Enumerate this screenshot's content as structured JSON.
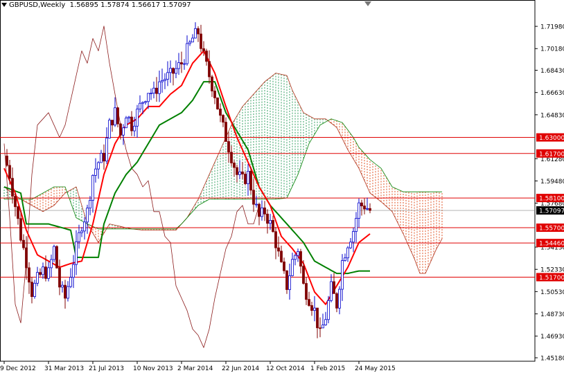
{
  "header": {
    "symbol": "GBPUSD,Weekly",
    "ohlc": "1.56895 1.57874 1.56617 1.57097"
  },
  "colors": {
    "bull_candle": "#0000cc",
    "bear_candle": "#800000",
    "tenkan": "#ff0000",
    "kijun": "#008000",
    "chikou": "#8b1a1a",
    "cloud_up": "#2e9e5e",
    "cloud_down": "#e05020",
    "level_line": "#e00000",
    "level_label_bg": "#e00000",
    "current_label_bg": "#000000",
    "grid": "#c8c8c8"
  },
  "chart_data": {
    "type": "candlestick",
    "title": "GBPUSD,Weekly",
    "ylim": [
      1.4518,
      1.7288
    ],
    "y_ticks": [
      "1.71980",
      "1.70180",
      "1.68430",
      "1.66630",
      "1.64830",
      "1.61280",
      "1.59480",
      "1.57680",
      "1.54130",
      "1.52330",
      "1.50530",
      "1.48730",
      "1.46930",
      "1.45180"
    ],
    "x_ticks": [
      "9 Dec 2012",
      "31 Mar 2013",
      "21 Jul 2013",
      "10 Nov 2013",
      "2 Mar 2014",
      "22 Jun 2014",
      "12 Oct 2014",
      "1 Feb 2015",
      "24 May 2015"
    ],
    "x_tick_index": [
      0,
      16,
      32,
      48,
      64,
      80,
      96,
      112,
      128
    ],
    "levels": [
      {
        "label": "1.63000",
        "value": 1.63
      },
      {
        "label": "1.61700",
        "value": 1.617
      },
      {
        "label": "1.58100",
        "value": 1.581
      },
      {
        "label": "1.55700",
        "value": 1.557
      },
      {
        "label": "1.54460",
        "value": 1.5446
      },
      {
        "label": "1.51700",
        "value": 1.517
      }
    ],
    "current_price": {
      "label": "1.57097",
      "value": 1.57097
    },
    "close_anchors": [
      [
        0,
        1.615
      ],
      [
        2,
        1.6
      ],
      [
        4,
        1.575
      ],
      [
        6,
        1.55
      ],
      [
        8,
        1.53
      ],
      [
        10,
        1.505
      ],
      [
        12,
        1.515
      ],
      [
        14,
        1.522
      ],
      [
        16,
        1.52
      ],
      [
        18,
        1.54
      ],
      [
        20,
        1.51
      ],
      [
        22,
        1.5
      ],
      [
        24,
        1.52
      ],
      [
        26,
        1.54
      ],
      [
        28,
        1.56
      ],
      [
        30,
        1.57
      ],
      [
        32,
        1.6
      ],
      [
        34,
        1.61
      ],
      [
        36,
        1.615
      ],
      [
        38,
        1.64
      ],
      [
        40,
        1.65
      ],
      [
        42,
        1.632
      ],
      [
        44,
        1.65
      ],
      [
        46,
        1.64
      ],
      [
        48,
        1.65
      ],
      [
        50,
        1.66
      ],
      [
        52,
        1.668
      ],
      [
        54,
        1.665
      ],
      [
        56,
        1.675
      ],
      [
        58,
        1.678
      ],
      [
        60,
        1.68
      ],
      [
        62,
        1.685
      ],
      [
        64,
        1.69
      ],
      [
        66,
        1.7
      ],
      [
        68,
        1.71
      ],
      [
        70,
        1.715
      ],
      [
        72,
        1.695
      ],
      [
        74,
        1.68
      ],
      [
        76,
        1.665
      ],
      [
        78,
        1.645
      ],
      [
        80,
        1.63
      ],
      [
        82,
        1.615
      ],
      [
        84,
        1.6
      ],
      [
        86,
        1.595
      ],
      [
        88,
        1.6
      ],
      [
        90,
        1.58
      ],
      [
        92,
        1.565
      ],
      [
        94,
        1.57
      ],
      [
        96,
        1.56
      ],
      [
        98,
        1.545
      ],
      [
        100,
        1.525
      ],
      [
        102,
        1.51
      ],
      [
        104,
        1.53
      ],
      [
        106,
        1.54
      ],
      [
        108,
        1.51
      ],
      [
        110,
        1.5
      ],
      [
        112,
        1.49
      ],
      [
        114,
        1.47
      ],
      [
        116,
        1.485
      ],
      [
        118,
        1.508
      ],
      [
        120,
        1.495
      ],
      [
        122,
        1.53
      ],
      [
        124,
        1.545
      ],
      [
        126,
        1.555
      ],
      [
        128,
        1.575
      ],
      [
        130,
        1.575
      ],
      [
        132,
        1.571
      ]
    ],
    "tenkan": [
      [
        0,
        1.605
      ],
      [
        4,
        1.585
      ],
      [
        8,
        1.555
      ],
      [
        12,
        1.535
      ],
      [
        16,
        1.53
      ],
      [
        20,
        1.525
      ],
      [
        24,
        1.528
      ],
      [
        28,
        1.53
      ],
      [
        32,
        1.56
      ],
      [
        36,
        1.6
      ],
      [
        40,
        1.625
      ],
      [
        44,
        1.64
      ],
      [
        48,
        1.645
      ],
      [
        52,
        1.655
      ],
      [
        56,
        1.655
      ],
      [
        60,
        1.665
      ],
      [
        64,
        1.672
      ],
      [
        68,
        1.69
      ],
      [
        72,
        1.7
      ],
      [
        76,
        1.682
      ],
      [
        80,
        1.655
      ],
      [
        84,
        1.63
      ],
      [
        88,
        1.61
      ],
      [
        92,
        1.59
      ],
      [
        96,
        1.575
      ],
      [
        100,
        1.55
      ],
      [
        104,
        1.54
      ],
      [
        108,
        1.528
      ],
      [
        112,
        1.505
      ],
      [
        116,
        1.495
      ],
      [
        120,
        1.51
      ],
      [
        124,
        1.525
      ],
      [
        128,
        1.545
      ],
      [
        132,
        1.552
      ]
    ],
    "kijun": [
      [
        0,
        1.59
      ],
      [
        6,
        1.585
      ],
      [
        8,
        1.56
      ],
      [
        16,
        1.56
      ],
      [
        24,
        1.555
      ],
      [
        26,
        1.533
      ],
      [
        34,
        1.533
      ],
      [
        36,
        1.56
      ],
      [
        40,
        1.585
      ],
      [
        44,
        1.6
      ],
      [
        48,
        1.61
      ],
      [
        52,
        1.625
      ],
      [
        56,
        1.64
      ],
      [
        60,
        1.645
      ],
      [
        64,
        1.65
      ],
      [
        68,
        1.66
      ],
      [
        72,
        1.675
      ],
      [
        76,
        1.675
      ],
      [
        80,
        1.65
      ],
      [
        84,
        1.635
      ],
      [
        88,
        1.62
      ],
      [
        90,
        1.605
      ],
      [
        92,
        1.59
      ],
      [
        96,
        1.575
      ],
      [
        100,
        1.565
      ],
      [
        104,
        1.555
      ],
      [
        108,
        1.545
      ],
      [
        112,
        1.53
      ],
      [
        120,
        1.52
      ],
      [
        124,
        1.52
      ],
      [
        128,
        1.522
      ],
      [
        132,
        1.522
      ]
    ],
    "chikou": [
      [
        0,
        1.625
      ],
      [
        2,
        1.565
      ],
      [
        4,
        1.495
      ],
      [
        6,
        1.48
      ],
      [
        8,
        1.53
      ],
      [
        10,
        1.6
      ],
      [
        12,
        1.64
      ],
      [
        14,
        1.645
      ],
      [
        16,
        1.65
      ],
      [
        18,
        1.64
      ],
      [
        20,
        1.63
      ],
      [
        22,
        1.64
      ],
      [
        24,
        1.66
      ],
      [
        26,
        1.68
      ],
      [
        28,
        1.7
      ],
      [
        30,
        1.69
      ],
      [
        32,
        1.71
      ],
      [
        34,
        1.7
      ],
      [
        36,
        1.72
      ],
      [
        38,
        1.69
      ],
      [
        40,
        1.665
      ],
      [
        42,
        1.64
      ],
      [
        44,
        1.62
      ],
      [
        46,
        1.605
      ],
      [
        48,
        1.6
      ],
      [
        50,
        1.59
      ],
      [
        52,
        1.595
      ],
      [
        54,
        1.57
      ],
      [
        56,
        1.57
      ],
      [
        58,
        1.55
      ],
      [
        60,
        1.545
      ],
      [
        62,
        1.51
      ],
      [
        64,
        1.5
      ],
      [
        66,
        1.49
      ],
      [
        68,
        1.475
      ],
      [
        70,
        1.47
      ],
      [
        72,
        1.46
      ],
      [
        74,
        1.475
      ],
      [
        76,
        1.5
      ],
      [
        78,
        1.52
      ],
      [
        80,
        1.54
      ],
      [
        82,
        1.55
      ],
      [
        84,
        1.57
      ],
      [
        86,
        1.575
      ],
      [
        88,
        1.56
      ],
      [
        90,
        1.56
      ],
      [
        92,
        1.575
      ]
    ],
    "span_a": [
      [
        0,
        1.59
      ],
      [
        6,
        1.58
      ],
      [
        10,
        1.575
      ],
      [
        14,
        1.57
      ],
      [
        18,
        1.575
      ],
      [
        22,
        1.585
      ],
      [
        26,
        1.59
      ],
      [
        30,
        1.56
      ],
      [
        34,
        1.545
      ],
      [
        38,
        1.56
      ],
      [
        42,
        1.558
      ],
      [
        46,
        1.556
      ],
      [
        50,
        1.555
      ],
      [
        54,
        1.555
      ],
      [
        58,
        1.555
      ],
      [
        62,
        1.555
      ],
      [
        64,
        1.56
      ],
      [
        66,
        1.565
      ],
      [
        70,
        1.58
      ],
      [
        74,
        1.6
      ],
      [
        78,
        1.62
      ],
      [
        82,
        1.64
      ],
      [
        86,
        1.655
      ],
      [
        90,
        1.665
      ],
      [
        94,
        1.675
      ],
      [
        98,
        1.682
      ],
      [
        102,
        1.68
      ],
      [
        104,
        1.668
      ],
      [
        108,
        1.65
      ],
      [
        112,
        1.645
      ],
      [
        116,
        1.645
      ],
      [
        120,
        1.638
      ],
      [
        124,
        1.62
      ],
      [
        128,
        1.605
      ],
      [
        132,
        1.585
      ],
      [
        136,
        1.578
      ],
      [
        140,
        1.57
      ],
      [
        144,
        1.552
      ],
      [
        148,
        1.532
      ],
      [
        150,
        1.52
      ],
      [
        152,
        1.52
      ],
      [
        154,
        1.53
      ],
      [
        156,
        1.54
      ],
      [
        158,
        1.548
      ]
    ],
    "span_b": [
      [
        0,
        1.58
      ],
      [
        6,
        1.58
      ],
      [
        10,
        1.58
      ],
      [
        14,
        1.585
      ],
      [
        18,
        1.59
      ],
      [
        22,
        1.59
      ],
      [
        26,
        1.565
      ],
      [
        30,
        1.56
      ],
      [
        34,
        1.556
      ],
      [
        38,
        1.556
      ],
      [
        42,
        1.556
      ],
      [
        46,
        1.556
      ],
      [
        50,
        1.556
      ],
      [
        54,
        1.556
      ],
      [
        58,
        1.556
      ],
      [
        62,
        1.556
      ],
      [
        64,
        1.56
      ],
      [
        66,
        1.565
      ],
      [
        70,
        1.575
      ],
      [
        74,
        1.58
      ],
      [
        78,
        1.58
      ],
      [
        82,
        1.58
      ],
      [
        86,
        1.58
      ],
      [
        90,
        1.58
      ],
      [
        94,
        1.58
      ],
      [
        98,
        1.58
      ],
      [
        102,
        1.581
      ],
      [
        106,
        1.6
      ],
      [
        110,
        1.625
      ],
      [
        114,
        1.64
      ],
      [
        118,
        1.645
      ],
      [
        122,
        1.642
      ],
      [
        126,
        1.63
      ],
      [
        128,
        1.622
      ],
      [
        132,
        1.612
      ],
      [
        136,
        1.605
      ],
      [
        140,
        1.59
      ],
      [
        144,
        1.586
      ],
      [
        148,
        1.586
      ],
      [
        152,
        1.586
      ],
      [
        156,
        1.586
      ],
      [
        158,
        1.586
      ]
    ]
  }
}
